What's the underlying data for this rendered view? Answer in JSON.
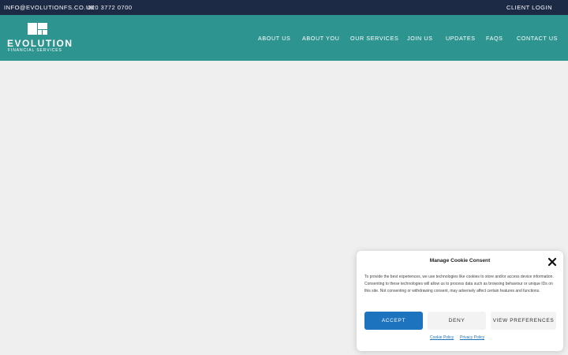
{
  "topbar": {
    "email": "INFO@EVOLUTIONFS.CO.UK",
    "phone": "020 3772 0700",
    "client_login": "CLIENT LOGIN"
  },
  "logo": {
    "wordmark": "EVOLUTION",
    "tagline": "FINANCIAL SERVICES"
  },
  "nav": {
    "items": [
      {
        "label": "ABOUT US"
      },
      {
        "label": "ABOUT YOU"
      },
      {
        "label": "OUR SERVICES"
      },
      {
        "label": "JOIN US"
      },
      {
        "label": "UPDATES"
      },
      {
        "label": "FAQS"
      },
      {
        "label": "CONTACT US"
      }
    ]
  },
  "cookie": {
    "title": "Manage Cookie Consent",
    "body": "To provide the best experiences, we use technologies like cookies to store and/or access device information. Consenting to these technologies will allow us to process data such as browsing behaviour or unique IDs on this site. Not consenting or withdrawing consent, may adversely affect certain features and functions.",
    "accept": "ACCEPT",
    "deny": "DENY",
    "preferences": "VIEW PREFERENCES",
    "cookie_policy": "Cookie Policy",
    "privacy_policy": "Privacy Policy",
    "close_icon": "close-icon"
  },
  "colors": {
    "topbar_bg": "#1c2a45",
    "header_bg": "#2e9490",
    "accent": "#1e73be",
    "page_bg": "#efefef"
  }
}
